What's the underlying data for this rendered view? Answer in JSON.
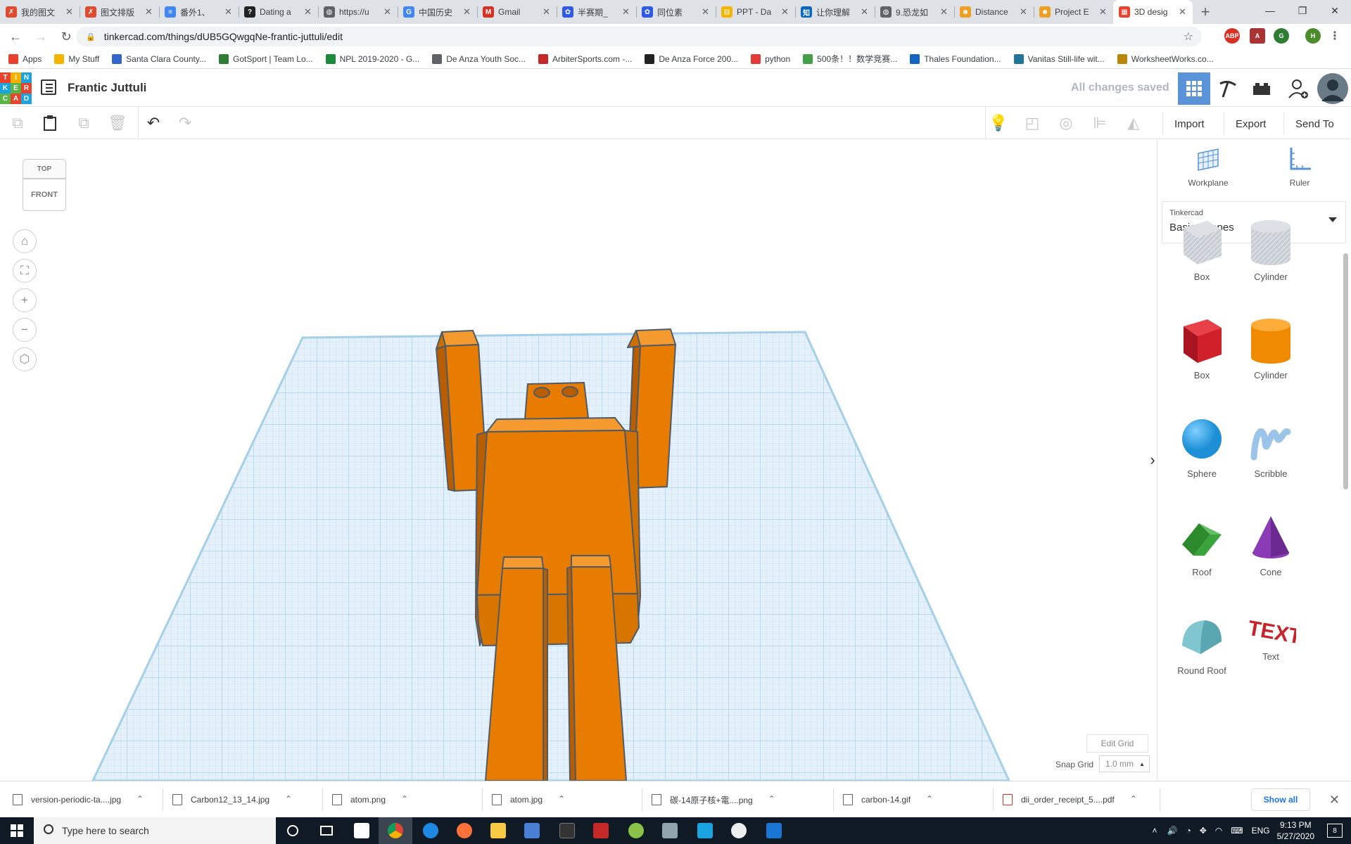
{
  "browser": {
    "tabs": [
      {
        "title": "我的图文",
        "color": "#e04a2f",
        "glyph": "✗"
      },
      {
        "title": "图文排版",
        "color": "#e04a2f",
        "glyph": "✗"
      },
      {
        "title": "番外1、",
        "color": "#4285f4",
        "glyph": "≡"
      },
      {
        "title": "Dating a",
        "color": "#222222",
        "glyph": "?"
      },
      {
        "title": "https://u",
        "color": "#5f6368",
        "glyph": "◍"
      },
      {
        "title": "中国历史",
        "color": "#4285f4",
        "glyph": "G"
      },
      {
        "title": "Gmail",
        "color": "#d93025",
        "glyph": "M"
      },
      {
        "title": "半赛期_",
        "color": "#2e5ae8",
        "glyph": "✿"
      },
      {
        "title": "同位素",
        "color": "#2e5ae8",
        "glyph": "✿"
      },
      {
        "title": "PPT - Da",
        "color": "#f4b400",
        "glyph": "⊟"
      },
      {
        "title": "让你理解",
        "color": "#0a66c2",
        "glyph": "知"
      },
      {
        "title": "9.恐龙如",
        "color": "#5f6368",
        "glyph": "◍"
      },
      {
        "title": "Distance",
        "color": "#f0a020",
        "glyph": "☻"
      },
      {
        "title": "Project E",
        "color": "#f0a020",
        "glyph": "☻"
      },
      {
        "title": "3D desig",
        "color": "#e8412c",
        "glyph": "▦"
      }
    ],
    "new_tab_label": "+",
    "window_controls": {
      "minimize": "—",
      "maximize": "❐",
      "close": "✕"
    },
    "url": "tinkercad.com/things/dUB5GQwgqNe-frantic-juttuli/edit",
    "bookmarks": [
      {
        "label": "Apps",
        "color": "#e8412c"
      },
      {
        "label": "My Stuff",
        "color": "#f4b400"
      },
      {
        "label": "Santa Clara County...",
        "color": "#3366cc"
      },
      {
        "label": "GotSport | Team Lo...",
        "color": "#2e7d32"
      },
      {
        "label": "NPL 2019-2020 - G...",
        "color": "#1b8a3a"
      },
      {
        "label": "De Anza Youth Soc...",
        "color": "#5f6368"
      },
      {
        "label": "ArbiterSports.com -...",
        "color": "#c62828"
      },
      {
        "label": "De Anza Force 200...",
        "color": "#222222"
      },
      {
        "label": "python",
        "color": "#e53935"
      },
      {
        "label": "500条！！数学竞赛...",
        "color": "#43a047"
      },
      {
        "label": "Thales Foundation...",
        "color": "#1565c0"
      },
      {
        "label": "Vanitas Still-life wit...",
        "color": "#21759b"
      },
      {
        "label": "WorksheetWorks.co...",
        "color": "#b8860b"
      }
    ],
    "avatar_letter": "H"
  },
  "tinkercad": {
    "logo_letters": [
      "T",
      "I",
      "N",
      "K",
      "E",
      "R",
      "C",
      "A",
      "D"
    ],
    "design_title": "Frantic Juttuli",
    "save_status": "All changes saved",
    "actions": {
      "import": "Import",
      "export": "Export",
      "send_to": "Send To"
    },
    "viewcube": {
      "top": "TOP",
      "front": "FRONT"
    },
    "edit_grid": "Edit Grid",
    "snap_grid_label": "Snap Grid",
    "snap_grid_value": "1.0 mm",
    "panel": {
      "workplane": "Workplane",
      "ruler": "Ruler",
      "library_source": "Tinkercad",
      "library_name": "Basic Shapes",
      "shapes": [
        {
          "label": "Box",
          "kind": "box-hole"
        },
        {
          "label": "Cylinder",
          "kind": "cyl-hole"
        },
        {
          "label": "Box",
          "kind": "box"
        },
        {
          "label": "Cylinder",
          "kind": "cyl"
        },
        {
          "label": "Sphere",
          "kind": "sphere"
        },
        {
          "label": "Scribble",
          "kind": "scribble"
        },
        {
          "label": "Roof",
          "kind": "roof"
        },
        {
          "label": "Cone",
          "kind": "cone"
        },
        {
          "label": "Round Roof",
          "kind": "roundroof"
        },
        {
          "label": "Text",
          "kind": "text"
        }
      ],
      "colors": {
        "box": "#d0202a",
        "cylinder": "#f08a00",
        "sphere": "#1d8fd6",
        "roof": "#3aa33a",
        "cone": "#8a3bb5",
        "roundroof": "#7fc6cf",
        "text": "#c8232a",
        "hole": "#b9bfc6"
      }
    },
    "model_color": "#e77c00"
  },
  "downloads": {
    "files": [
      {
        "name": "version-periodic-ta....jpg",
        "type": "img"
      },
      {
        "name": "Carbon12_13_14.jpg",
        "type": "img"
      },
      {
        "name": "atom.png",
        "type": "img"
      },
      {
        "name": "atom.jpg",
        "type": "img"
      },
      {
        "name": "碳-14原子核+電....png",
        "type": "img"
      },
      {
        "name": "carbon-14.gif",
        "type": "img"
      },
      {
        "name": "dii_order_receipt_5....pdf",
        "type": "pdf"
      }
    ],
    "show_all": "Show all"
  },
  "taskbar": {
    "search_placeholder": "Type here to search",
    "language": "ENG",
    "time": "9:13 PM",
    "date": "5/27/2020",
    "notification_count": "8"
  }
}
